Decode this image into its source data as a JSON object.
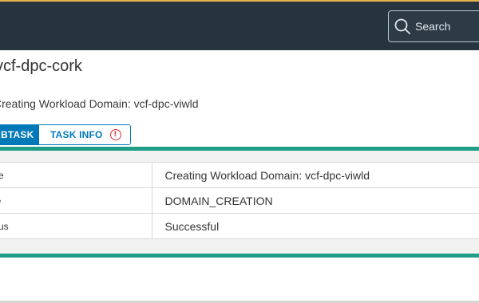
{
  "header": {
    "search_placeholder": "Search",
    "search_icon": "search-icon",
    "background_color": "#26343f"
  },
  "page": {
    "title": "vcf-dpc-cork",
    "subtitle": "Creating Workload Domain: vcf-dpc-viwld"
  },
  "tabs": [
    {
      "label": "BTASK",
      "active": true
    },
    {
      "label": "TASK INFO",
      "active": false,
      "icon": "warning-icon"
    }
  ],
  "details": {
    "rows": [
      {
        "key": "me",
        "value": "Creating Workload Domain: vcf-dpc-viwld"
      },
      {
        "key": "pe",
        "value": "DOMAIN_CREATION"
      },
      {
        "key": "atus",
        "value": "Successful"
      }
    ]
  },
  "colors": {
    "accent": "#0079b8",
    "highlight": "#1f9d86",
    "warning": "#e02b2b"
  }
}
